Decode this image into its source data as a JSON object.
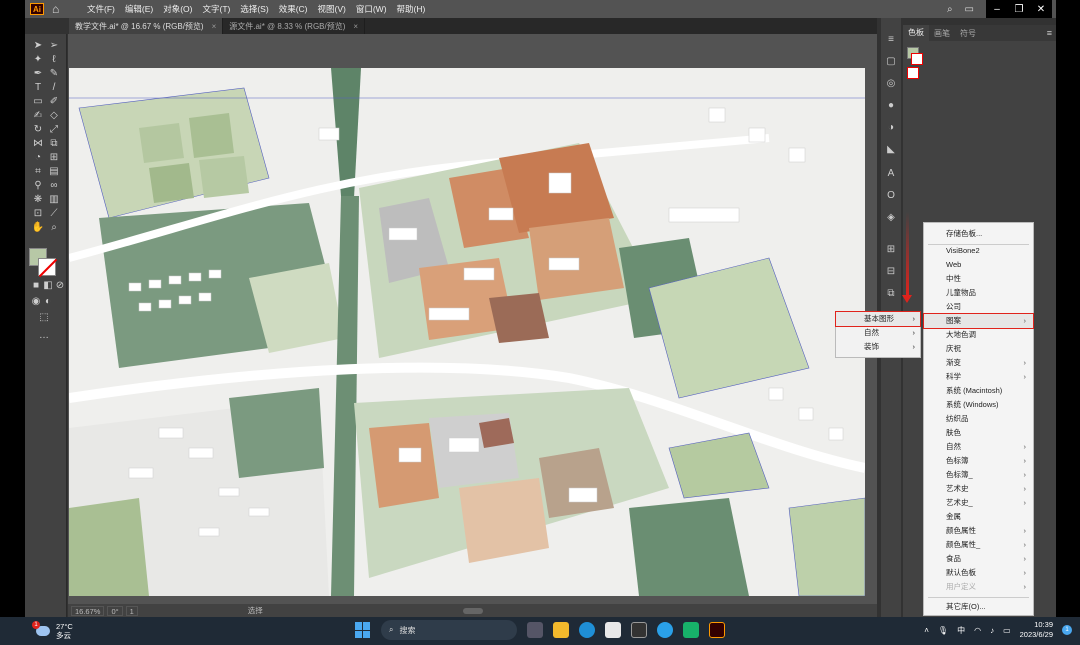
{
  "app": {
    "logo": "Ai",
    "menus": [
      "文件(F)",
      "编辑(E)",
      "对象(O)",
      "文字(T)",
      "选择(S)",
      "效果(C)",
      "视图(V)",
      "窗口(W)",
      "帮助(H)"
    ]
  },
  "tabs": [
    {
      "label": "教学文件.ai* @ 16.67 % (RGB/预览)",
      "active": true
    },
    {
      "label": "源文件.ai* @ 8.33 % (RGB/预览)",
      "active": false
    }
  ],
  "status": {
    "zoom": "16.67%",
    "rotation": "0°",
    "artboard": "1",
    "mode": "选择"
  },
  "panel": {
    "tabs": [
      "色板",
      "画笔",
      "符号"
    ]
  },
  "submenu": {
    "items": [
      {
        "label": "基本图形",
        "has_arrow": true,
        "highlighted": true
      },
      {
        "label": "自然",
        "has_arrow": true,
        "highlighted": false
      },
      {
        "label": "装饰",
        "has_arrow": true,
        "highlighted": false
      }
    ]
  },
  "library_menu": {
    "items": [
      {
        "label": "存储色板...",
        "has_arrow": false
      },
      {
        "label": "VisiBone2",
        "has_arrow": false
      },
      {
        "label": "Web",
        "has_arrow": false
      },
      {
        "label": "中性",
        "has_arrow": false
      },
      {
        "label": "儿童物品",
        "has_arrow": false
      },
      {
        "label": "公司",
        "has_arrow": false
      },
      {
        "label": "图案",
        "has_arrow": true,
        "highlighted": true
      },
      {
        "label": "大地色调",
        "has_arrow": false
      },
      {
        "label": "庆祝",
        "has_arrow": false
      },
      {
        "label": "渐变",
        "has_arrow": true
      },
      {
        "label": "科学",
        "has_arrow": true
      },
      {
        "label": "系统 (Macintosh)",
        "has_arrow": false
      },
      {
        "label": "系统 (Windows)",
        "has_arrow": false
      },
      {
        "label": "纺织品",
        "has_arrow": false
      },
      {
        "label": "肤色",
        "has_arrow": false
      },
      {
        "label": "自然",
        "has_arrow": true
      },
      {
        "label": "色标簿",
        "has_arrow": true
      },
      {
        "label": "色标簿_",
        "has_arrow": true
      },
      {
        "label": "艺术史",
        "has_arrow": true
      },
      {
        "label": "艺术史_",
        "has_arrow": true
      },
      {
        "label": "金属",
        "has_arrow": false
      },
      {
        "label": "颜色属性",
        "has_arrow": true
      },
      {
        "label": "颜色属性_",
        "has_arrow": true
      },
      {
        "label": "食品",
        "has_arrow": true
      },
      {
        "label": "默认色板",
        "has_arrow": true
      },
      {
        "label": "用户定义",
        "has_arrow": true,
        "disabled": true
      },
      {
        "label": "其它库(O)...",
        "has_arrow": false
      }
    ]
  },
  "taskbar": {
    "weather_temp": "27°C",
    "weather_desc": "多云",
    "weather_badge": "1",
    "search": "搜索",
    "ime": "中",
    "time": "10:39",
    "date": "2023/6/29",
    "notif": "1"
  }
}
